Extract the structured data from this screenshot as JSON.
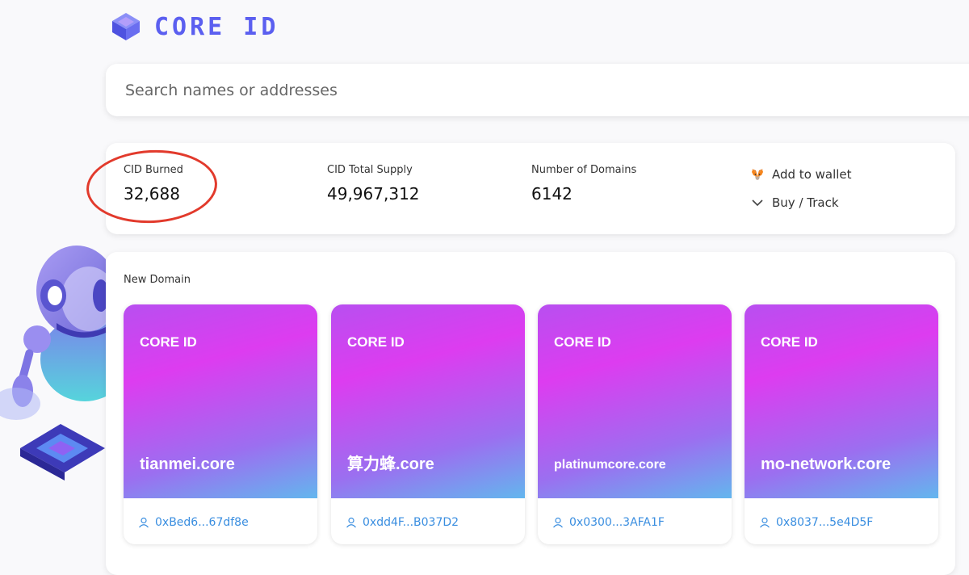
{
  "brand": {
    "name": "CORE ID"
  },
  "search": {
    "placeholder": "Search names or addresses"
  },
  "stats": [
    {
      "label": "CID Burned",
      "value": "32,688"
    },
    {
      "label": "CID Total Supply",
      "value": "49,967,312"
    },
    {
      "label": "Number of Domains",
      "value": "6142"
    }
  ],
  "actions": {
    "add_wallet": "Add to wallet",
    "buy_track": "Buy / Track"
  },
  "new_domain": {
    "title": "New Domain",
    "cards": [
      {
        "brand": "CORE ID",
        "name": "tianmei.core",
        "owner": "0xBed6...67df8e"
      },
      {
        "brand": "CORE ID",
        "name": "算力蜂.core",
        "owner": "0xdd4F...B037D2"
      },
      {
        "brand": "CORE ID",
        "name": "platinumcore.core",
        "owner": "0x0300...3AFA1F"
      },
      {
        "brand": "CORE ID",
        "name": "mo-network.core",
        "owner": "0x8037...5e4D5F"
      }
    ]
  },
  "colors": {
    "accent": "#5b5ff0",
    "highlight_circle": "#e23a2c",
    "owner_link": "#3a8ee0"
  }
}
